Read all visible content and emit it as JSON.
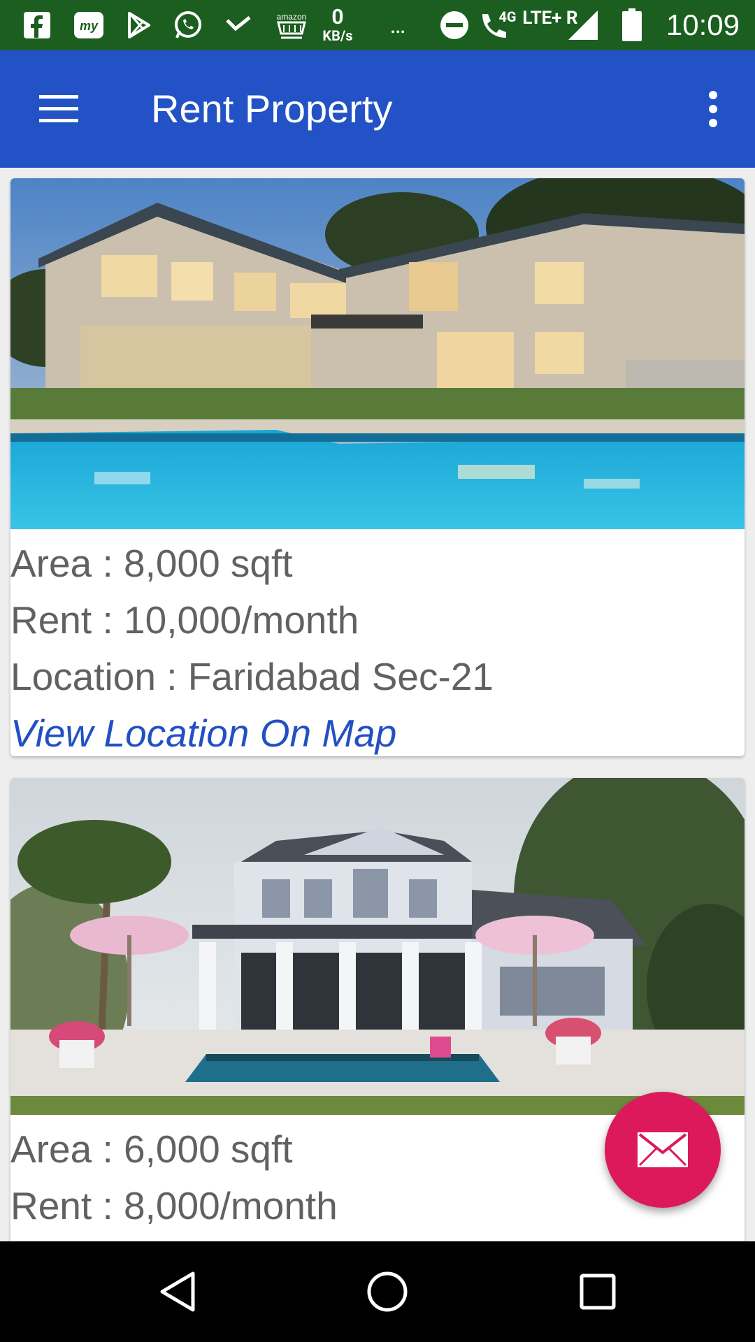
{
  "status_bar": {
    "time": "10:09",
    "net_speed_value": "0",
    "net_speed_unit": "KB/s",
    "network_type": "4G",
    "lte_label": "LTE+ R",
    "more_notifications": "…",
    "bg_color": "#1b5e20"
  },
  "app_bar": {
    "title": "Rent Property",
    "bg_color": "#2352c6"
  },
  "listings": [
    {
      "area": "Area : 8,000 sqft",
      "rent": "Rent : 10,000/month",
      "location": "Location : Faridabad Sec-21",
      "map_link": "View Location On Map"
    },
    {
      "area": "Area : 6,000 sqft",
      "rent": "Rent : 8,000/month"
    }
  ],
  "fab": {
    "icon": "mail-icon",
    "color": "#dc1a5b"
  },
  "nav_bar": {
    "icons": [
      "back-icon",
      "home-icon",
      "recents-icon"
    ]
  }
}
